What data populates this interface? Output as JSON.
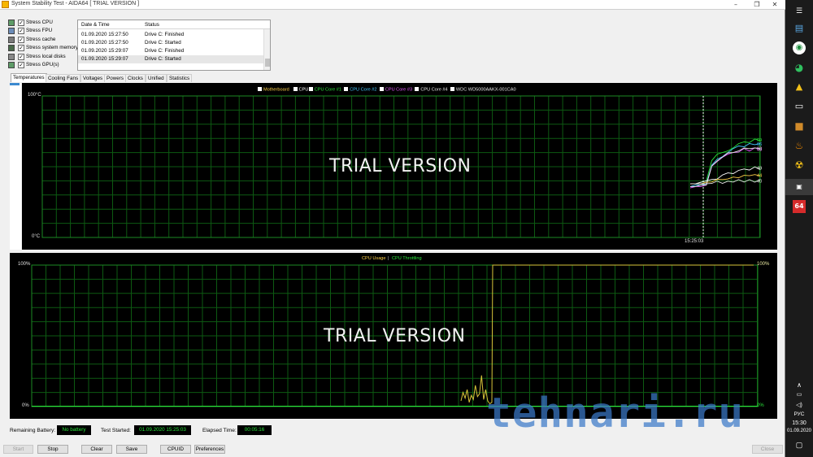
{
  "window": {
    "title": "System Stability Test - AIDA64  [ TRIAL VERSION ]"
  },
  "stress": {
    "items": [
      {
        "label": "Stress CPU",
        "checked": true,
        "icon": "cpu-icon"
      },
      {
        "label": "Stress FPU",
        "checked": true,
        "icon": "fpu-icon"
      },
      {
        "label": "Stress cache",
        "checked": true,
        "icon": "cache-icon"
      },
      {
        "label": "Stress system memory",
        "checked": true,
        "icon": "memory-icon"
      },
      {
        "label": "Stress local disks",
        "checked": true,
        "icon": "disk-icon"
      },
      {
        "label": "Stress GPU(s)",
        "checked": true,
        "icon": "gpu-icon"
      }
    ]
  },
  "log": {
    "columns": [
      "Date & Time",
      "Status"
    ],
    "rows": [
      {
        "time": "01.09.2020 15:27:50",
        "status": "Drive C: Finished"
      },
      {
        "time": "01.09.2020 15:27:50",
        "status": "Drive C: Started"
      },
      {
        "time": "01.09.2020 15:29:07",
        "status": "Drive C: Finished"
      },
      {
        "time": "01.09.2020 15:29:07",
        "status": "Drive C: Started"
      }
    ]
  },
  "tabs": [
    "Temperatures",
    "Cooling Fans",
    "Voltages",
    "Powers",
    "Clocks",
    "Unified",
    "Statistics"
  ],
  "temp_chart": {
    "legend": [
      {
        "label": "Motherboard",
        "color": "#ffd24a"
      },
      {
        "label": "CPU",
        "color": "#ffffff"
      },
      {
        "label": "CPU Core #1",
        "color": "#29e33a"
      },
      {
        "label": "CPU Core #2",
        "color": "#43c8ff"
      },
      {
        "label": "CPU Core #3",
        "color": "#e55bff"
      },
      {
        "label": "CPU Core #4",
        "color": "#e8e8e8"
      },
      {
        "label": "WDC WD5000AAKX-001CA0",
        "color": "#e8e8e8"
      }
    ],
    "y_top": "100°C",
    "y_bottom": "0°C",
    "time_label": "15:25:03",
    "watermark": "TRIAL VERSION",
    "end_labels": [
      {
        "text": "69",
        "color": "#29e33a",
        "value": 69
      },
      {
        "text": "66",
        "color": "#43c8ff",
        "value": 66
      },
      {
        "text": "63",
        "color": "#e8e8e8",
        "value": 63
      },
      {
        "text": "63",
        "color": "#e55bff",
        "value": 62.5
      },
      {
        "text": "49",
        "color": "#ffffff",
        "value": 49
      },
      {
        "text": "44",
        "color": "#ffd24a",
        "value": 44
      },
      {
        "text": "40",
        "color": "#e8e8e8",
        "value": 40
      }
    ]
  },
  "usage_chart": {
    "legend": [
      {
        "label": "CPU Usage",
        "color": "#ffd24a"
      },
      {
        "label": "CPU Throttling",
        "color": "#29e33a"
      }
    ],
    "legend_sep": "|",
    "y_top": "100%",
    "y_bottom": "0%",
    "right_top": "100%",
    "right_bottom": "0%",
    "watermark": "TRIAL VERSION"
  },
  "status": {
    "battery_label": "Remaining Battery:",
    "battery_value": "No battery",
    "started_label": "Test Started:",
    "started_value": "01.09.2020 15:25:03",
    "elapsed_label": "Elapsed Time:",
    "elapsed_value": "00:05:16"
  },
  "buttons": {
    "start": "Start",
    "stop": "Stop",
    "clear": "Clear",
    "save": "Save",
    "cpuid": "CPUID",
    "preferences": "Preferences",
    "close": "Close"
  },
  "watermark_site": "tehnari.ru",
  "tray": {
    "lang": "РУС",
    "time": "15:30",
    "date": "01.09.2020"
  },
  "chart_data": [
    {
      "type": "line",
      "title": "",
      "ylim": [
        0,
        100
      ],
      "yticks": [
        "100°C",
        "0°C"
      ],
      "xticks": [
        "15:25:03"
      ],
      "grid": true,
      "legend": "top-center",
      "series": [
        {
          "name": "CPU Core #1",
          "values": [
            38,
            38,
            39,
            40,
            54,
            58,
            60,
            62,
            64,
            66,
            67,
            68,
            69,
            69
          ]
        },
        {
          "name": "CPU Core #2",
          "values": [
            36,
            37,
            37,
            38,
            52,
            56,
            58,
            60,
            62,
            64,
            65,
            66,
            66,
            66
          ]
        },
        {
          "name": "CPU Core #3",
          "values": [
            35,
            36,
            36,
            37,
            50,
            54,
            56,
            58,
            60,
            61,
            62,
            62,
            63,
            63
          ]
        },
        {
          "name": "CPU Core #4",
          "values": [
            36,
            36,
            37,
            37,
            51,
            55,
            57,
            59,
            60,
            62,
            63,
            63,
            63,
            63
          ]
        },
        {
          "name": "CPU",
          "values": [
            38,
            38,
            39,
            40,
            41,
            42,
            44,
            45,
            46,
            47,
            48,
            48,
            49,
            49
          ]
        },
        {
          "name": "Motherboard",
          "values": [
            38,
            38,
            38,
            39,
            40,
            41,
            41,
            42,
            42,
            43,
            43,
            44,
            44,
            44
          ]
        },
        {
          "name": "WDC WD5000AAKX-001CA0",
          "values": [
            38,
            38,
            38,
            38,
            39,
            39,
            39,
            39,
            40,
            40,
            40,
            40,
            40,
            40
          ]
        }
      ]
    },
    {
      "type": "line",
      "title": "",
      "ylim": [
        0,
        100
      ],
      "yticks": [
        "100%",
        "0%"
      ],
      "grid": true,
      "legend": "top-center",
      "series": [
        {
          "name": "CPU Usage",
          "values": [
            4,
            10,
            6,
            12,
            3,
            8,
            5,
            15,
            7,
            9,
            22,
            5,
            12,
            4,
            2,
            3,
            100,
            100,
            100,
            100,
            100,
            100,
            100,
            100,
            100,
            100,
            100,
            100,
            100
          ]
        },
        {
          "name": "CPU Throttling",
          "values": [
            0,
            0,
            0,
            0,
            0,
            0,
            0,
            0,
            0,
            0,
            0,
            0,
            0,
            0,
            0,
            0,
            0,
            0,
            0,
            0,
            0,
            0,
            0,
            0,
            0,
            0,
            0,
            0,
            0
          ]
        }
      ]
    }
  ]
}
